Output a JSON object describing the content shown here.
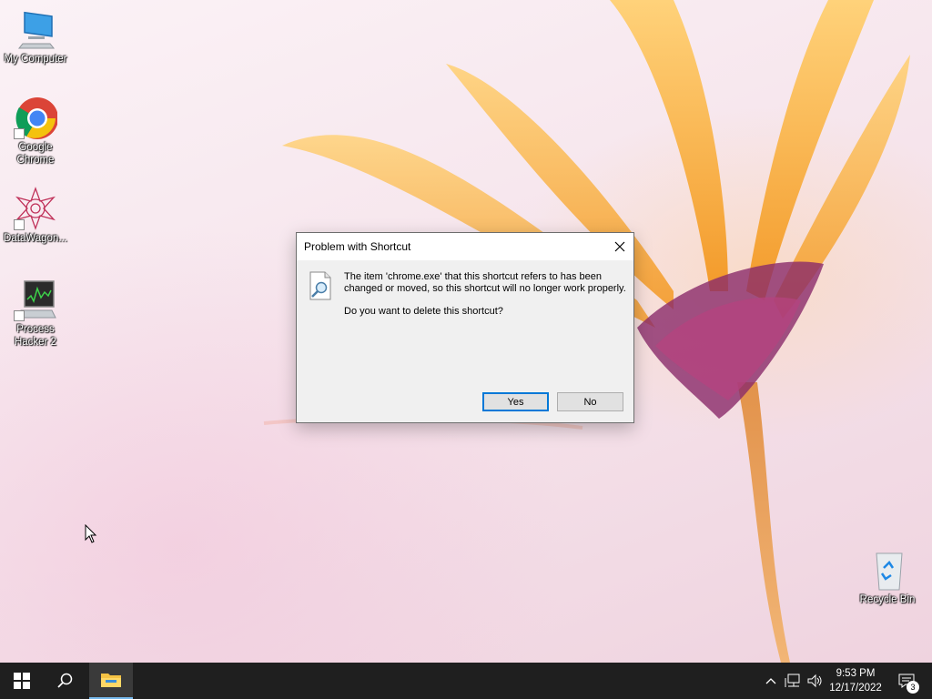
{
  "desktop": {
    "icons": [
      {
        "label": "My Computer"
      },
      {
        "label": "Google Chrome"
      },
      {
        "label": "DataWagon..."
      },
      {
        "label": "Process Hacker 2"
      },
      {
        "label": "Recycle Bin"
      }
    ]
  },
  "dialog": {
    "title": "Problem with Shortcut",
    "message": "The item 'chrome.exe' that this shortcut refers to has been changed or moved, so this shortcut will no longer work properly.",
    "question": "Do you want to delete this shortcut?",
    "yes_label": "Yes",
    "no_label": "No"
  },
  "taskbar": {
    "time": "9:53 PM",
    "date": "12/17/2022",
    "notification_count": "3"
  }
}
